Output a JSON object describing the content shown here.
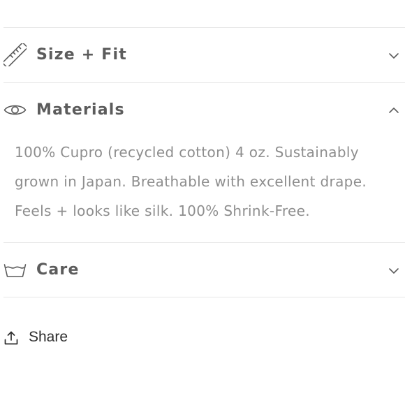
{
  "accordion": {
    "items": [
      {
        "title": "Size + Fit",
        "icon": "ruler-icon",
        "expanded": false
      },
      {
        "title": "Materials",
        "icon": "eye-icon",
        "expanded": true,
        "content": [
          "100% Cupro (recycled cotton) 4 oz. Sustainably",
          "grown in Japan. Breathable with excellent drape.",
          "Feels + looks like silk. 100% Shrink-Free."
        ]
      },
      {
        "title": "Care",
        "icon": "wash-basin-icon",
        "expanded": false
      }
    ]
  },
  "share": {
    "label": "Share",
    "icon": "share-icon"
  },
  "colors": {
    "text": "#5c5c5c",
    "body_text": "#8e8e8e",
    "divider": "#e6e6e6",
    "share_text": "#2d2d2d"
  }
}
